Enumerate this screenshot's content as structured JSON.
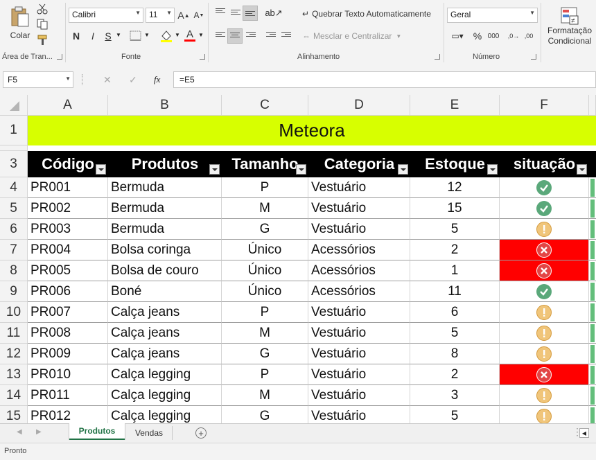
{
  "ribbon": {
    "clipboard": {
      "paste_label": "Colar",
      "group_label": "Área de Tran..."
    },
    "font": {
      "font_name": "Calibri",
      "font_size": "11",
      "bold": "N",
      "italic": "I",
      "underline": "S",
      "group_label": "Fonte",
      "font_color": "#ff0000"
    },
    "alignment": {
      "wrap_text": "Quebrar Texto Automaticamente",
      "merge_center": "Mesclar e Centralizar",
      "group_label": "Alinhamento"
    },
    "number": {
      "format": "Geral",
      "percent": "%",
      "thousands": "000",
      "group_label": "Número"
    },
    "styles": {
      "conditional_line1": "Formatação",
      "conditional_line2": "Condicional"
    }
  },
  "formula_bar": {
    "name_box": "F5",
    "cancel": "✕",
    "enter": "✓",
    "fx": "fx",
    "formula": "=E5"
  },
  "columns": [
    "A",
    "B",
    "C",
    "D",
    "E",
    "F"
  ],
  "sheet": {
    "title": "Meteora",
    "title_bg": "#d7ff00",
    "headers": [
      "Código",
      "Produtos",
      "Tamanho",
      "Categoria",
      "Estoque",
      "situação"
    ],
    "rows": [
      {
        "num": "4",
        "codigo": "PR001",
        "produto": "Bermuda",
        "tamanho": "P",
        "categoria": "Vestuário",
        "estoque": "12",
        "status": "ok"
      },
      {
        "num": "5",
        "codigo": "PR002",
        "produto": "Bermuda",
        "tamanho": "M",
        "categoria": "Vestuário",
        "estoque": "15",
        "status": "ok"
      },
      {
        "num": "6",
        "codigo": "PR003",
        "produto": "Bermuda",
        "tamanho": "G",
        "categoria": "Vestuário",
        "estoque": "5",
        "status": "warn"
      },
      {
        "num": "7",
        "codigo": "PR004",
        "produto": "Bolsa coringa",
        "tamanho": "Único",
        "categoria": "Acessórios",
        "estoque": "2",
        "status": "bad"
      },
      {
        "num": "8",
        "codigo": "PR005",
        "produto": "Bolsa de couro",
        "tamanho": "Único",
        "categoria": "Acessórios",
        "estoque": "1",
        "status": "bad"
      },
      {
        "num": "9",
        "codigo": "PR006",
        "produto": "Boné",
        "tamanho": "Único",
        "categoria": "Acessórios",
        "estoque": "11",
        "status": "ok"
      },
      {
        "num": "10",
        "codigo": "PR007",
        "produto": "Calça jeans",
        "tamanho": "P",
        "categoria": "Vestuário",
        "estoque": "6",
        "status": "warn"
      },
      {
        "num": "11",
        "codigo": "PR008",
        "produto": "Calça jeans",
        "tamanho": "M",
        "categoria": "Vestuário",
        "estoque": "5",
        "status": "warn"
      },
      {
        "num": "12",
        "codigo": "PR009",
        "produto": "Calça jeans",
        "tamanho": "G",
        "categoria": "Vestuário",
        "estoque": "8",
        "status": "warn"
      },
      {
        "num": "13",
        "codigo": "PR010",
        "produto": "Calça legging",
        "tamanho": "P",
        "categoria": "Vestuário",
        "estoque": "2",
        "status": "bad"
      },
      {
        "num": "14",
        "codigo": "PR011",
        "produto": "Calça legging",
        "tamanho": "M",
        "categoria": "Vestuário",
        "estoque": "3",
        "status": "warn"
      },
      {
        "num": "15",
        "codigo": "PR012",
        "produto": "Calça legging",
        "tamanho": "G",
        "categoria": "Vestuário",
        "estoque": "5",
        "status": "warn"
      }
    ]
  },
  "status_colors": {
    "bad_fill": "#ff0000",
    "ok_icon": "#5aa87a",
    "warn_icon": "#f0c57a",
    "data_bar": "#63be7b"
  },
  "tabs": [
    {
      "label": "Produtos",
      "active": true
    },
    {
      "label": "Vendas",
      "active": false
    }
  ],
  "status_bar": {
    "text": "Pronto"
  }
}
